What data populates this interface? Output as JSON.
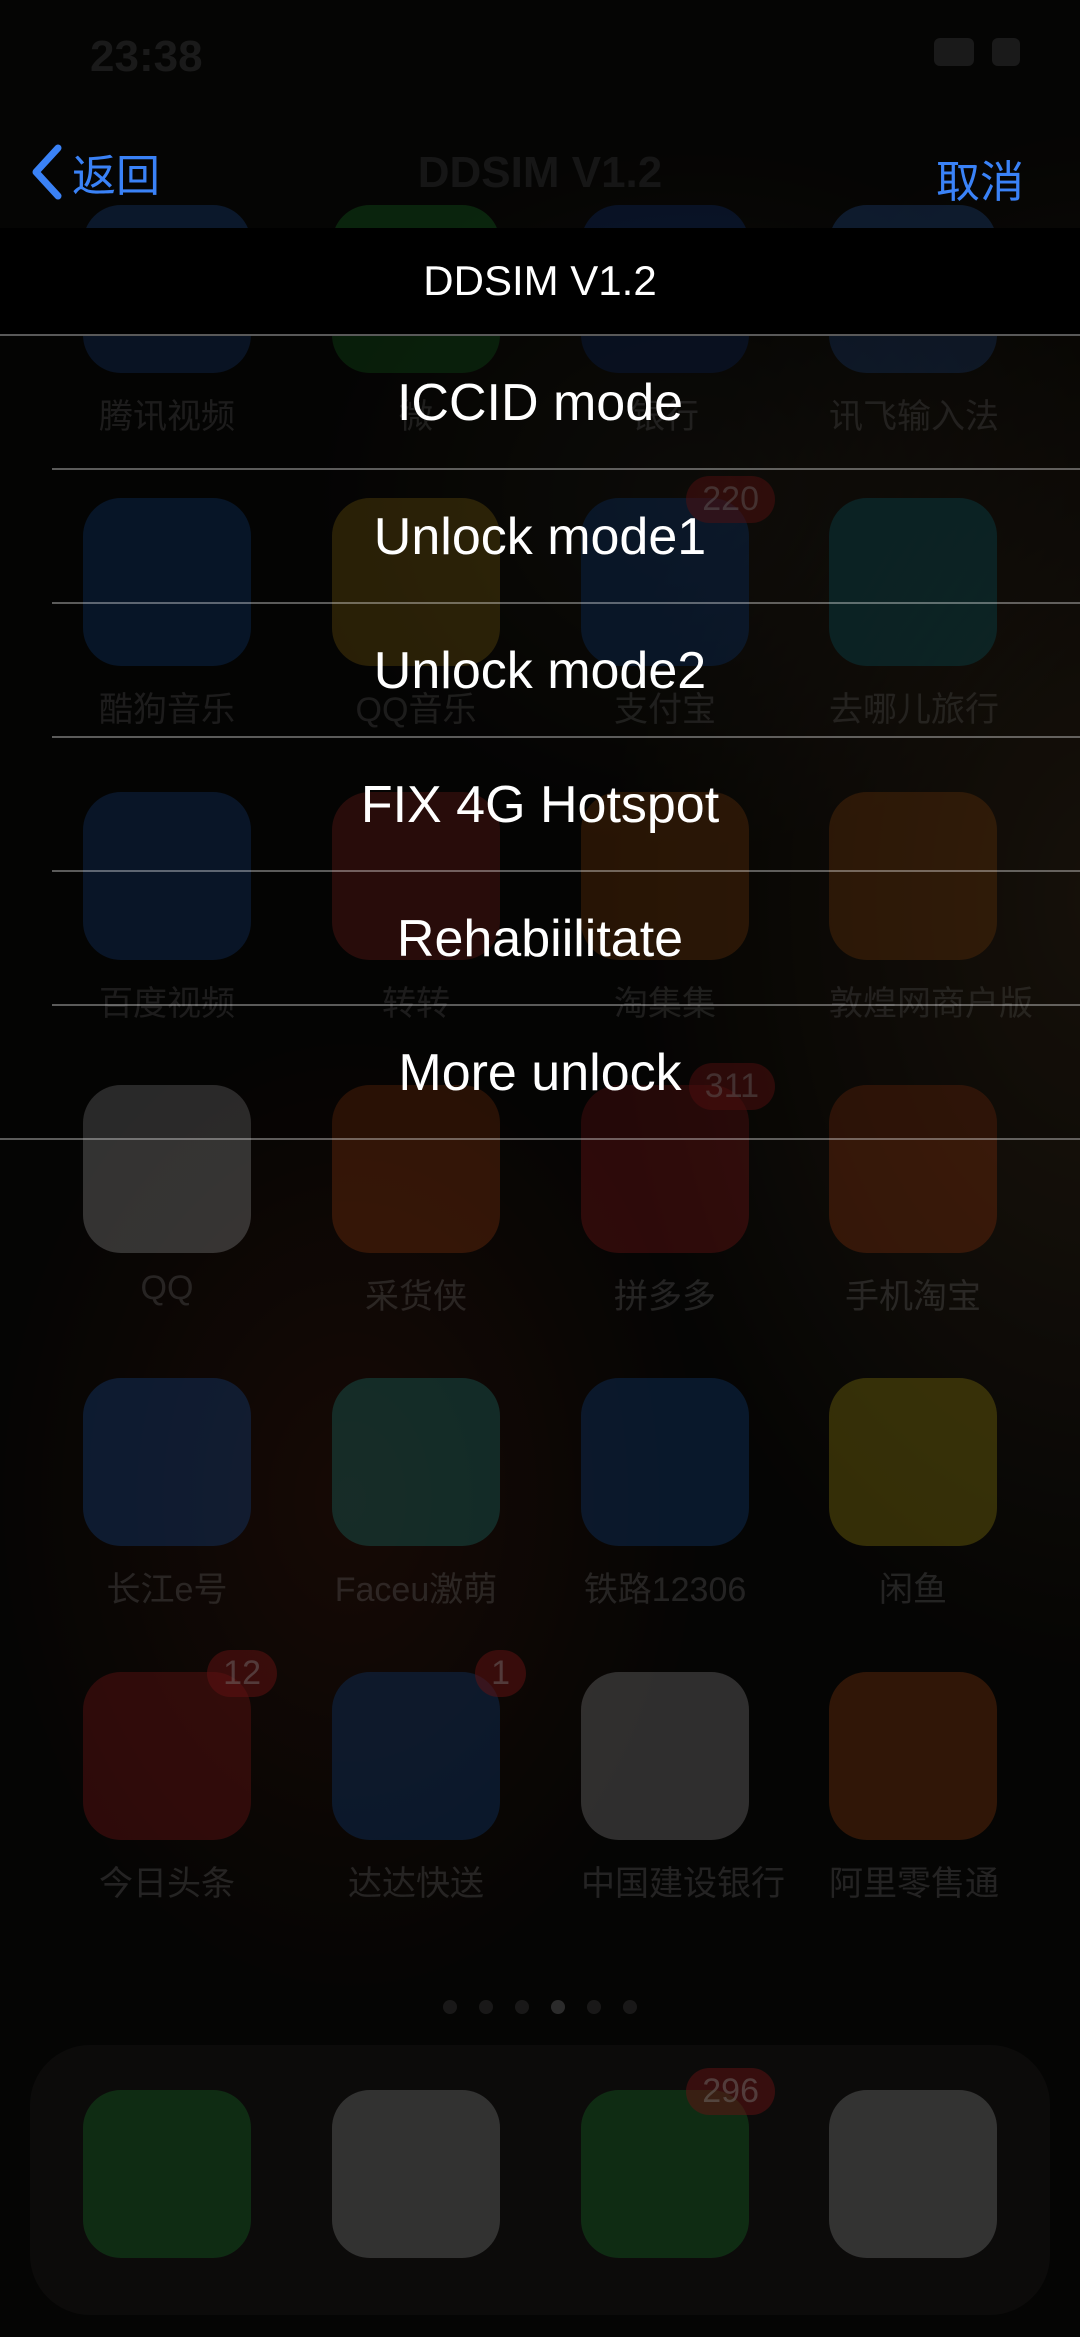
{
  "status_bar": {
    "time": "23:38"
  },
  "nav": {
    "back_label": "返回",
    "title": "DDSIM V1.2",
    "cancel_label": "取消"
  },
  "sheet": {
    "title": "DDSIM V1.2",
    "items": [
      {
        "label": "ICCID mode"
      },
      {
        "label": "Unlock mode1"
      },
      {
        "label": "Unlock mode2"
      },
      {
        "label": "FIX 4G Hotspot"
      },
      {
        "label": "Rehabiilitate"
      },
      {
        "label": "More unlock"
      }
    ]
  },
  "home_apps": [
    {
      "name": "腾讯视频",
      "color": "#2a6fd6"
    },
    {
      "name": "微",
      "color": "#27b33a"
    },
    {
      "name": "银行",
      "color": "#1b4fb8"
    },
    {
      "name": "讯飞输入法",
      "color": "#3a7be0"
    },
    {
      "name": "酷狗音乐",
      "color": "#1f7cf0",
      "badge": ""
    },
    {
      "name": "QQ音乐",
      "color": "#f7c21e"
    },
    {
      "name": "支付宝",
      "color": "#1c73e8",
      "badge": "220"
    },
    {
      "name": "去哪儿旅行",
      "color": "#17b2c9"
    },
    {
      "name": "百度视频",
      "color": "#2a7cf0"
    },
    {
      "name": "转转",
      "color": "#f2433c"
    },
    {
      "name": "淘集集",
      "color": "#f07a1b"
    },
    {
      "name": "敦煌网商户版",
      "color": "#f07a1b"
    },
    {
      "name": "QQ",
      "color": "#ffffff"
    },
    {
      "name": "采货侠",
      "color": "#f0601b"
    },
    {
      "name": "拼多多",
      "color": "#e02a2a",
      "badge": "311"
    },
    {
      "name": "手机淘宝",
      "color": "#f45b1a"
    },
    {
      "name": "长江e号",
      "color": "#2a7cf0"
    },
    {
      "name": "Faceu激萌",
      "color": "#36d0c0"
    },
    {
      "name": "铁路12306",
      "color": "#1f6fd6"
    },
    {
      "name": "闲鱼",
      "color": "#ffe21a"
    },
    {
      "name": "今日头条",
      "color": "#e02a2a",
      "badge": "12"
    },
    {
      "name": "达达快送",
      "color": "#1f6fd6",
      "badge": "1"
    },
    {
      "name": "中国建设银行",
      "color": "#e8e8e8"
    },
    {
      "name": "阿里零售通",
      "color": "#f06a1b"
    }
  ],
  "dock_apps": [
    {
      "name": "phone-app",
      "color": "#2fc84a"
    },
    {
      "name": "safari-app",
      "color": "#e8e8e8"
    },
    {
      "name": "messages-app",
      "color": "#2fc84a",
      "badge": "296"
    },
    {
      "name": "music-app",
      "color": "#ececec"
    }
  ]
}
